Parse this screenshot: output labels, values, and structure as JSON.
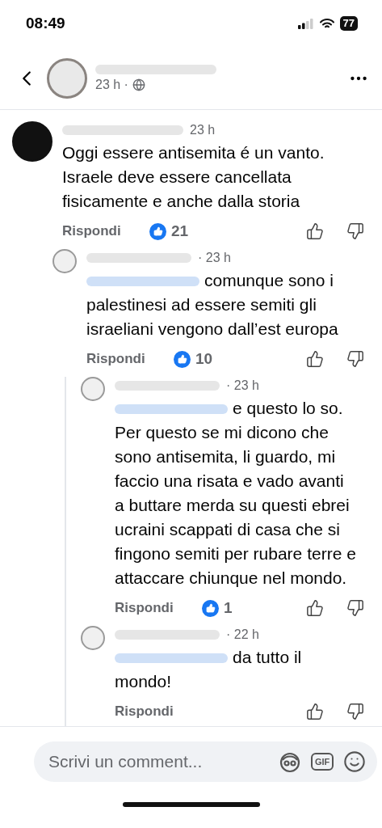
{
  "status_bar": {
    "time": "08:49",
    "battery": "77"
  },
  "header": {
    "time": "23 h ·"
  },
  "comments": [
    {
      "time": "23 h",
      "mention": false,
      "text": "Oggi essere antisemita é un vanto. Israele deve essere cancellata fisicamente e anche dalla storia",
      "reply": "Rispondi",
      "likes": "21",
      "children": [
        {
          "time": "· 23 h",
          "mention": true,
          "text": "comunque sono i palestinesi ad essere semiti gli israeliani vengono dall’est europa",
          "reply": "Rispondi",
          "likes": "10",
          "children": [
            {
              "time": "· 23 h",
              "mention": true,
              "text": "e questo lo so. Per questo se mi dicono che sono antisemita, li guardo, mi faccio una risata e vado avanti a buttare merda su questi ebrei ucraini scappati di casa che si fingono semiti per rubare terre e attaccare chiunque nel mondo.",
              "reply": "Rispondi",
              "likes": "1"
            },
            {
              "time": "· 22 h",
              "mention": true,
              "text": "da tutto il mondo!",
              "reply": "Rispondi"
            }
          ]
        }
      ]
    }
  ],
  "composer": {
    "placeholder": "Scrivi un comment...",
    "gif": "GIF"
  }
}
